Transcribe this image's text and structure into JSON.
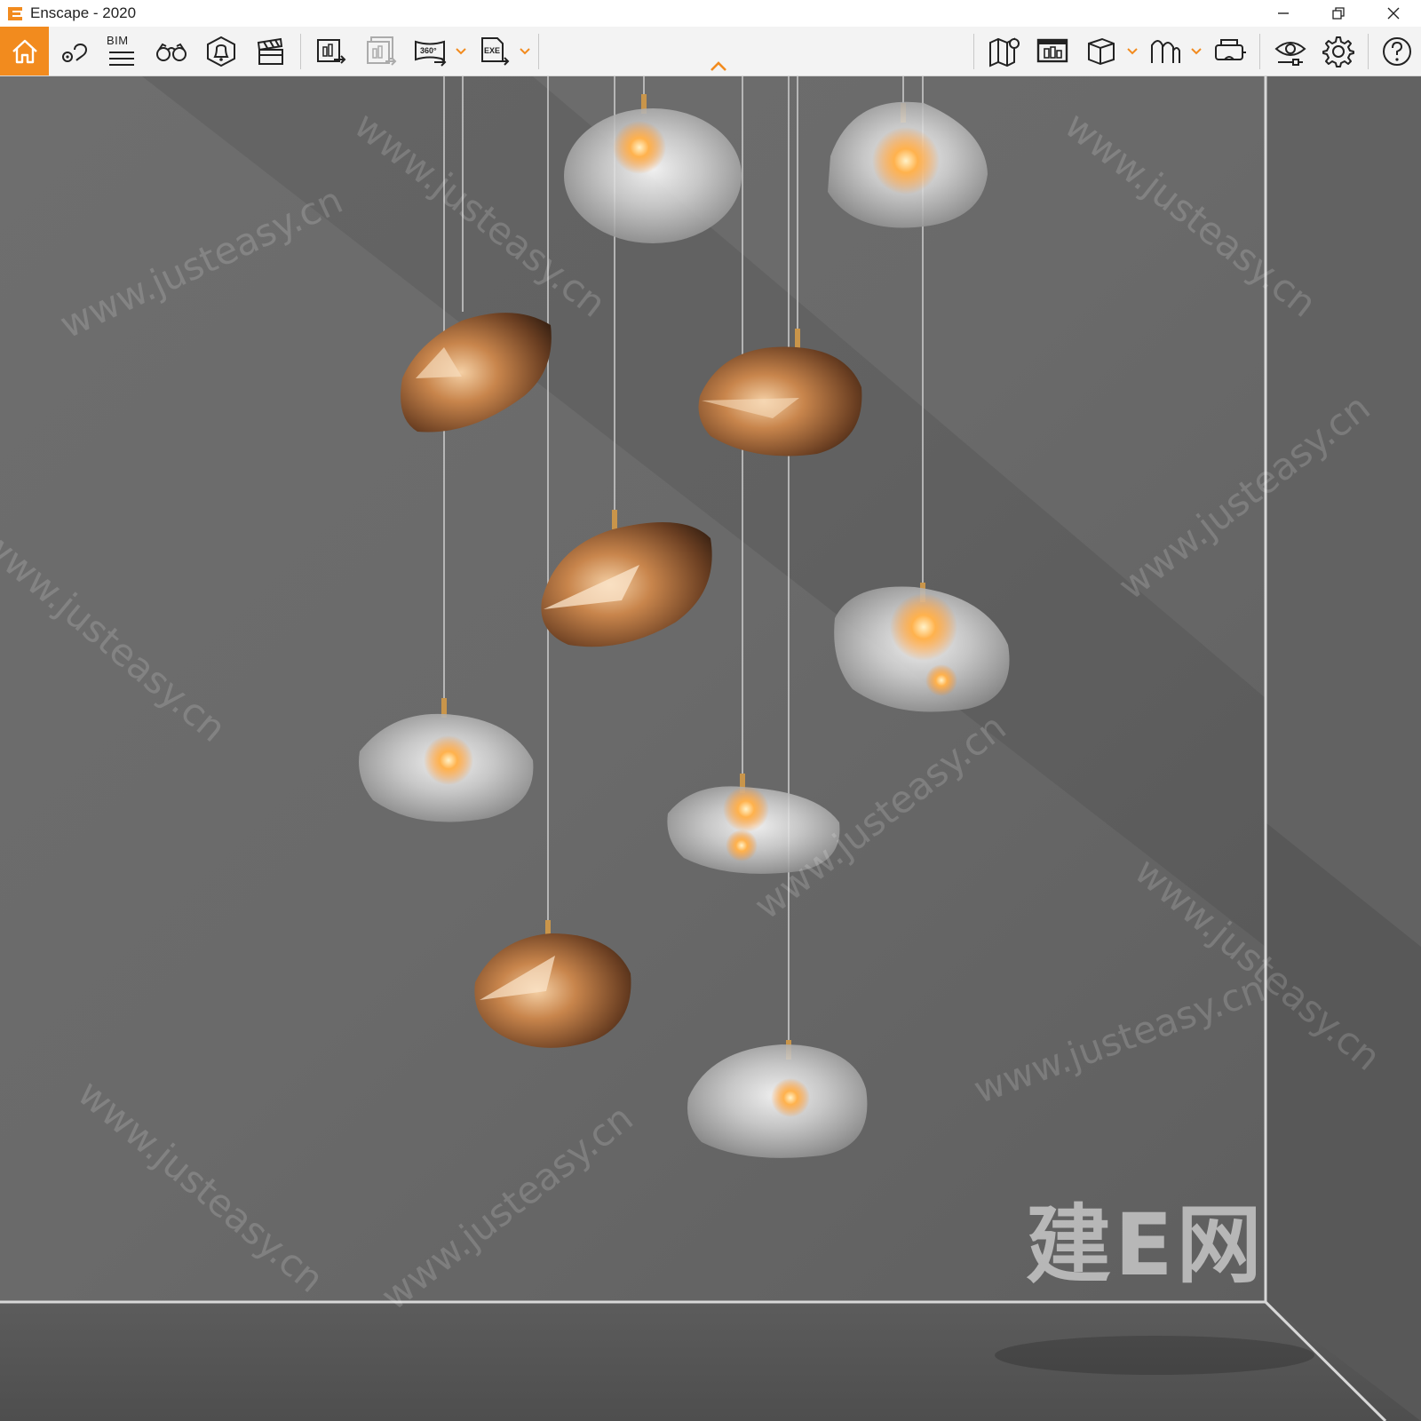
{
  "window": {
    "app_name": "Enscape",
    "title": "Enscape - 2020",
    "controls": [
      "minimize",
      "restore",
      "close"
    ]
  },
  "toolbar": {
    "left_tools": [
      {
        "name": "home",
        "icon": "home-icon",
        "active": true
      },
      {
        "name": "views",
        "icon": "location-pin-icon"
      },
      {
        "name": "bim",
        "icon": "bim-list-icon",
        "label": "BIM"
      },
      {
        "name": "walk",
        "icon": "binoculars-icon"
      },
      {
        "name": "atmosphere",
        "icon": "bell-icon"
      },
      {
        "name": "video",
        "icon": "clapperboard-icon"
      },
      {
        "name": "render-screenshot",
        "icon": "render-export-icon"
      },
      {
        "name": "batch-render",
        "icon": "batch-render-icon",
        "disabled": true
      },
      {
        "name": "panorama",
        "icon": "panorama-360-icon",
        "label": "360°",
        "dropdown": true
      },
      {
        "name": "export-exe",
        "icon": "export-exe-icon",
        "label": "EXE",
        "dropdown": true
      }
    ],
    "right_tools": [
      {
        "name": "map",
        "icon": "map-icon"
      },
      {
        "name": "asset-library",
        "icon": "asset-library-icon"
      },
      {
        "name": "view-mode",
        "icon": "cube-icon",
        "dropdown": true
      },
      {
        "name": "materials",
        "icon": "material-arches-icon",
        "dropdown": true
      },
      {
        "name": "vr",
        "icon": "vr-headset-icon"
      },
      {
        "name": "visual-settings",
        "icon": "eye-settings-icon"
      },
      {
        "name": "settings",
        "icon": "gear-icon"
      },
      {
        "name": "help",
        "icon": "help-icon"
      }
    ],
    "accent_color": "#f28b1e"
  },
  "viewport": {
    "description_colors": {
      "wall": "#6a6a6a",
      "floor": "#5a5a5a",
      "copper": "#b07040",
      "glow": "#ffb24d"
    },
    "watermark": {
      "logo": "建E网",
      "url": "www.justeasy.cn"
    }
  }
}
